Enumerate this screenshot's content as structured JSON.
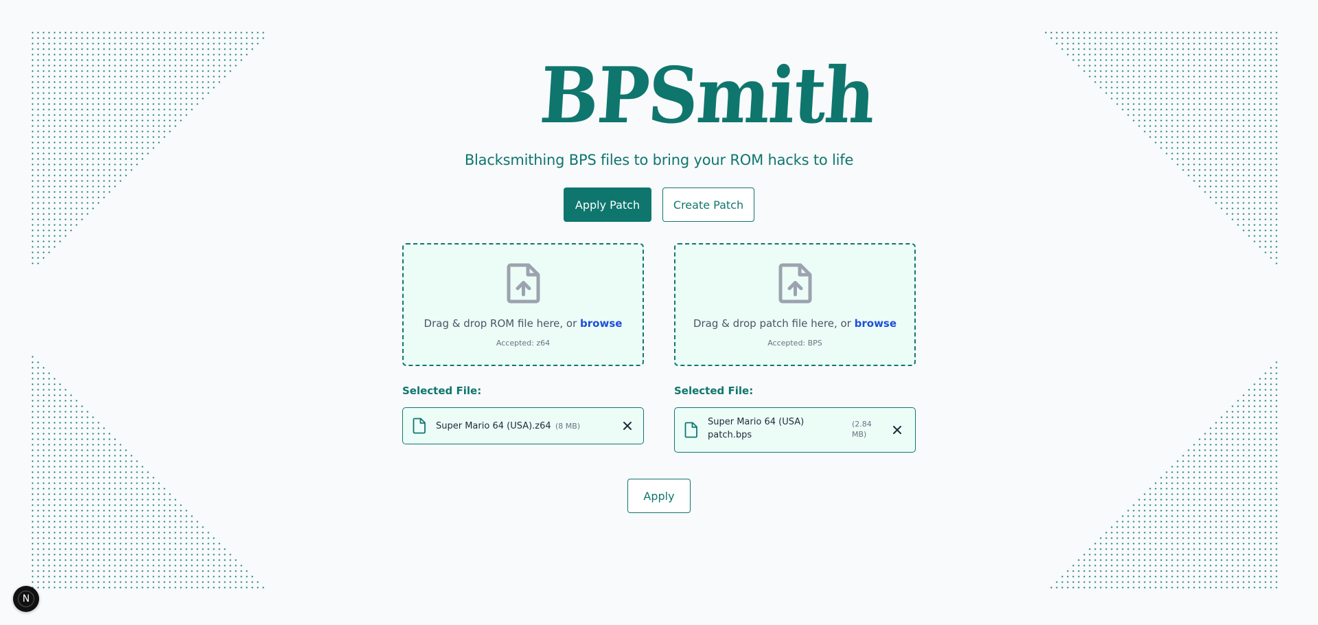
{
  "app": {
    "logo_text": "BPSmith",
    "tagline": "Blacksmithing BPS files to bring your ROM hacks to life"
  },
  "mode_tabs": {
    "apply_patch": "Apply Patch",
    "create_patch": "Create Patch",
    "active": "apply_patch"
  },
  "rom_dropzone": {
    "text": "Drag & drop ROM file here, or ",
    "browse": "browse",
    "accepted": "Accepted: z64",
    "icon": "file-upload-icon"
  },
  "patch_dropzone": {
    "text": "Drag & drop patch file here, or ",
    "browse": "browse",
    "accepted": "Accepted: BPS",
    "icon": "file-upload-icon"
  },
  "rom_selected": {
    "label": "Selected File:",
    "file_name": "Super Mario 64 (USA).z64",
    "file_size": "(8 MB)",
    "icon": "file-icon",
    "remove_icon": "close-icon"
  },
  "patch_selected": {
    "label": "Selected File:",
    "file_name": "Super Mario 64 (USA) patch.bps",
    "file_size": "(2.84 MB)",
    "icon": "file-icon",
    "remove_icon": "close-icon"
  },
  "actions": {
    "apply": "Apply"
  },
  "dev_badge": {
    "letter": "N"
  },
  "colors": {
    "accent": "#0f766e",
    "dropzone_bg": "#ecfdf8",
    "page_bg": "#f8fafb",
    "link": "#1d4ed8"
  }
}
